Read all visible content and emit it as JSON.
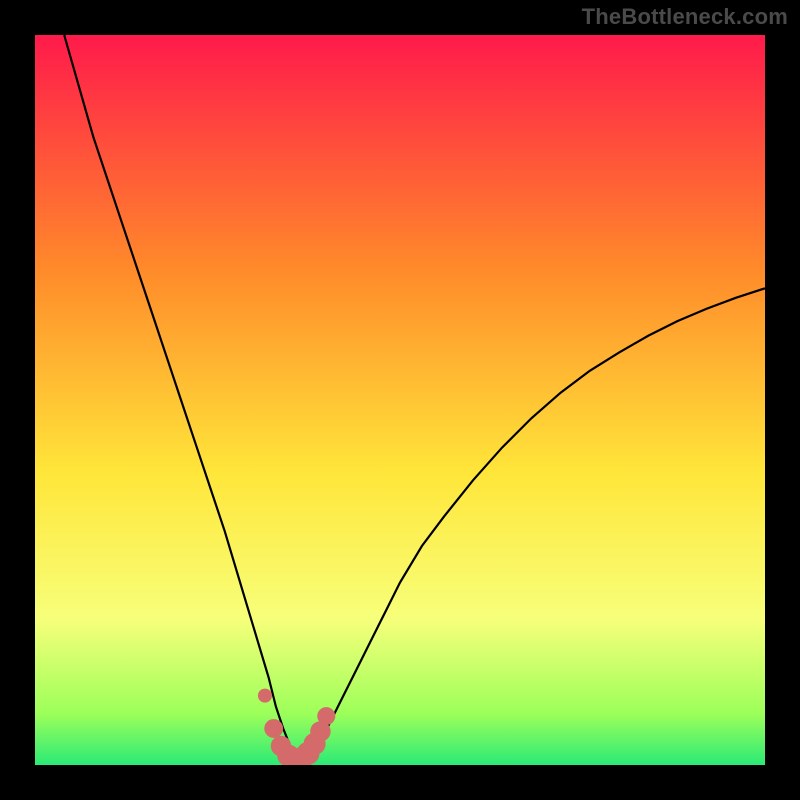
{
  "watermark": "TheBottleneck.com",
  "colors": {
    "frame_bg": "#000000",
    "grad_top": "#ff1a4b",
    "grad_mid1": "#ff8a2a",
    "grad_mid2": "#ffe63a",
    "grad_lower": "#f7ff7a",
    "grad_green1": "#9cff5a",
    "grad_green2": "#2bea76",
    "curve_stroke": "#000000",
    "marker_fill": "#d46a6a",
    "marker_stroke": "#b94f4f"
  },
  "chart_data": {
    "type": "line",
    "title": "",
    "xlabel": "",
    "ylabel": "",
    "xlim": [
      0,
      100
    ],
    "ylim": [
      0,
      100
    ],
    "series": [
      {
        "name": "bottleneck-curve",
        "x": [
          4,
          6,
          8,
          10,
          12,
          14,
          16,
          18,
          20,
          22,
          24,
          26,
          27.5,
          29,
          30.5,
          32,
          33,
          34,
          35,
          36,
          38,
          40,
          42,
          44,
          46,
          48,
          50,
          53,
          56,
          60,
          64,
          68,
          72,
          76,
          80,
          84,
          88,
          92,
          96,
          100
        ],
        "y": [
          100,
          93,
          86,
          80,
          74,
          68,
          62,
          56,
          50,
          44,
          38,
          32,
          27,
          22,
          17,
          12,
          8,
          5,
          2.5,
          1,
          2,
          5,
          9,
          13,
          17,
          21,
          25,
          30,
          34,
          39,
          43.5,
          47.5,
          51,
          54,
          56.5,
          58.8,
          60.8,
          62.5,
          64,
          65.3
        ]
      }
    ],
    "markers": {
      "name": "bottom-markers",
      "points": [
        {
          "x": 31.5,
          "y": 9.5,
          "r": 1.0
        },
        {
          "x": 32.7,
          "y": 5.0,
          "r": 1.6
        },
        {
          "x": 33.7,
          "y": 2.6,
          "r": 1.8
        },
        {
          "x": 34.7,
          "y": 1.3,
          "r": 2.0
        },
        {
          "x": 35.6,
          "y": 0.8,
          "r": 2.0
        },
        {
          "x": 36.5,
          "y": 0.9,
          "r": 2.1
        },
        {
          "x": 37.4,
          "y": 1.6,
          "r": 2.1
        },
        {
          "x": 38.3,
          "y": 2.9,
          "r": 2.0
        },
        {
          "x": 39.1,
          "y": 4.6,
          "r": 1.8
        },
        {
          "x": 39.9,
          "y": 6.7,
          "r": 1.5
        }
      ]
    },
    "gradient_stops": [
      {
        "offset": 0.0,
        "key": "grad_top"
      },
      {
        "offset": 0.32,
        "key": "grad_mid1"
      },
      {
        "offset": 0.6,
        "key": "grad_mid2"
      },
      {
        "offset": 0.8,
        "key": "grad_lower"
      },
      {
        "offset": 0.93,
        "key": "grad_green1"
      },
      {
        "offset": 1.0,
        "key": "grad_green2"
      }
    ]
  }
}
